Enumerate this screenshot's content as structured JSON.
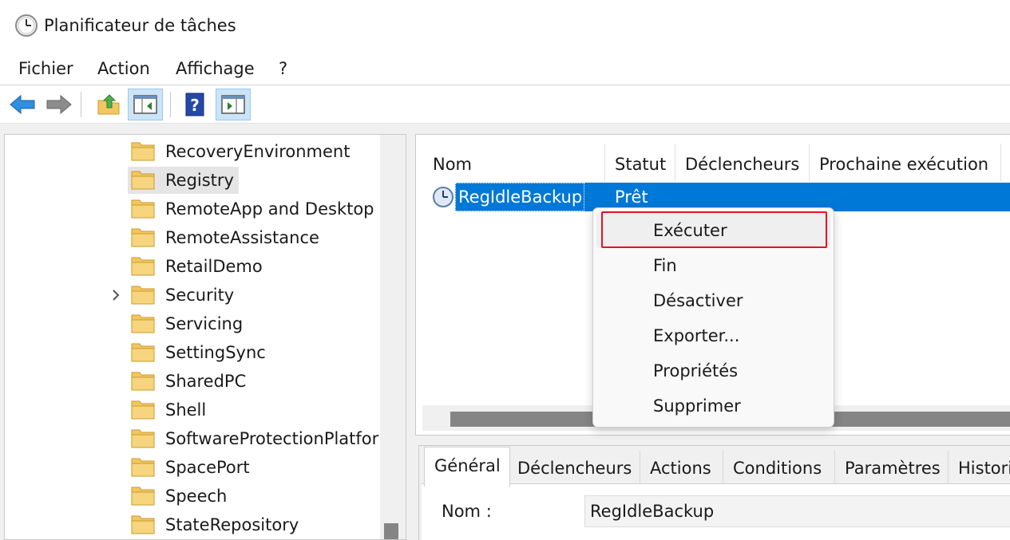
{
  "window": {
    "title": "Planificateur de tâches"
  },
  "menu": {
    "items": [
      "Fichier",
      "Action",
      "Affichage",
      "?"
    ]
  },
  "toolbar": {
    "buttons": [
      {
        "icon": "back-arrow-icon"
      },
      {
        "icon": "forward-arrow-icon"
      },
      {
        "icon": "folder-up-icon"
      },
      {
        "icon": "show-hide-console-tree-icon"
      },
      {
        "icon": "help-icon"
      },
      {
        "icon": "show-action-pane-icon"
      }
    ]
  },
  "tree": {
    "items": [
      {
        "label": "RecoveryEnvironment"
      },
      {
        "label": "Registry",
        "selected": true
      },
      {
        "label": "RemoteApp and Desktop"
      },
      {
        "label": "RemoteAssistance"
      },
      {
        "label": "RetailDemo"
      },
      {
        "label": "Security",
        "expandable": true
      },
      {
        "label": "Servicing"
      },
      {
        "label": "SettingSync"
      },
      {
        "label": "SharedPC"
      },
      {
        "label": "Shell"
      },
      {
        "label": "SoftwareProtectionPlatfor"
      },
      {
        "label": "SpacePort"
      },
      {
        "label": "Speech"
      },
      {
        "label": "StateRepository"
      }
    ]
  },
  "task_list": {
    "columns": [
      "Nom",
      "Statut",
      "Déclencheurs",
      "Prochaine exécution"
    ],
    "rows": [
      {
        "name": "RegIdleBackup",
        "status": "Prêt"
      }
    ]
  },
  "context_menu": {
    "items": [
      "Exécuter",
      "Fin",
      "Désactiver",
      "Exporter...",
      "Propriétés",
      "Supprimer"
    ],
    "highlighted_item": "Exécuter",
    "highlight_color": "#e8131f"
  },
  "details": {
    "tabs": [
      "Général",
      "Déclencheurs",
      "Actions",
      "Conditions",
      "Paramètres",
      "Histori"
    ],
    "active_tab": "Général",
    "name_label": "Nom :",
    "name_value": "RegIdleBackup"
  },
  "colors": {
    "selection": "#0078d7",
    "folder": "#f3c75f"
  }
}
